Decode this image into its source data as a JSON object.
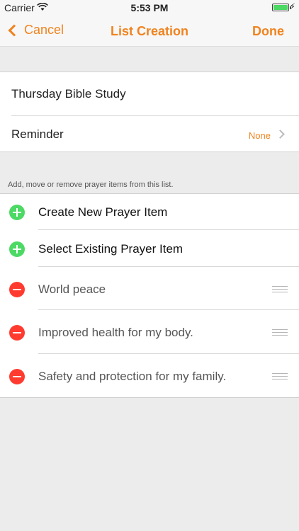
{
  "status": {
    "carrier": "Carrier",
    "time": "5:53 PM"
  },
  "nav": {
    "back_label": "Cancel",
    "title": "List Creation",
    "done_label": "Done"
  },
  "list": {
    "name": "Thursday Bible Study",
    "reminder_label": "Reminder",
    "reminder_value": "None"
  },
  "section_caption": "Add, move or remove prayer items from this list.",
  "actions": [
    {
      "label": "Create New Prayer Item"
    },
    {
      "label": "Select Existing Prayer Item"
    }
  ],
  "items": [
    {
      "label": "World peace"
    },
    {
      "label": "Improved health for my body."
    },
    {
      "label": "Safety and protection for my family."
    }
  ],
  "colors": {
    "accent": "#f0831e",
    "add": "#4cd964",
    "remove": "#ff3b30"
  }
}
